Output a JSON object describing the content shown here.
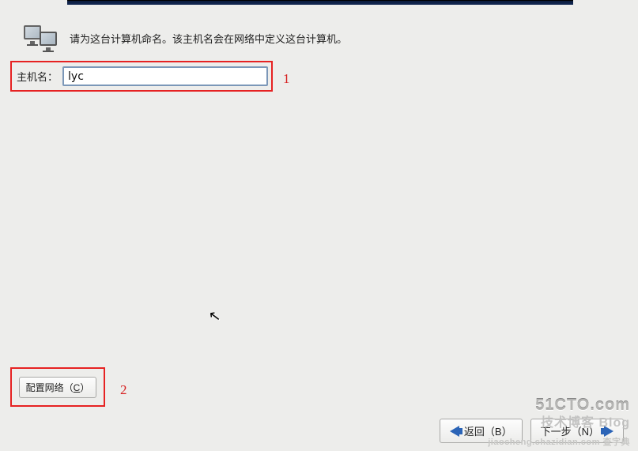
{
  "instruction": "请为这台计算机命名。该主机名会在网络中定义这台计算机。",
  "hostname": {
    "label": "主机名：",
    "value": "lyc"
  },
  "annotations": {
    "one": "1",
    "two": "2"
  },
  "buttons": {
    "configure_network": {
      "prefix": "配置网络（",
      "hotkey": "C",
      "suffix": "）"
    },
    "back": {
      "prefix": "返回（",
      "hotkey": "B",
      "suffix": "）"
    },
    "next": {
      "prefix": "下一步（",
      "hotkey": "N",
      "suffix": "）"
    }
  },
  "watermark": {
    "line1": "51CTO.com",
    "line2": "技术博客   Blog",
    "line3": "jiaocheng.chazidian.com 查字典"
  }
}
